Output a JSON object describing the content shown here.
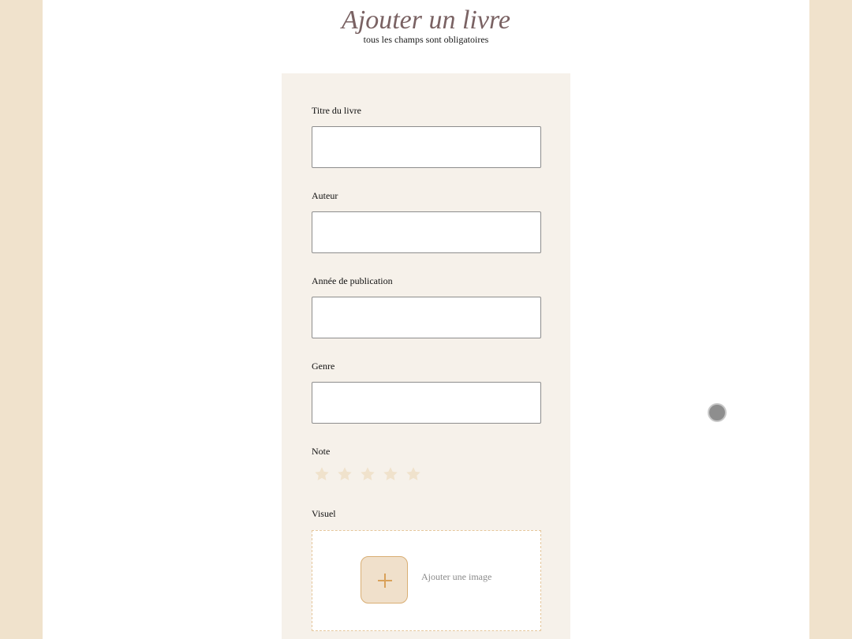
{
  "header": {
    "title": "Ajouter un livre",
    "subtitle": "tous les champs sont obligatoires"
  },
  "form": {
    "fields": [
      {
        "label": "Titre du livre",
        "value": "",
        "placeholder": ""
      },
      {
        "label": "Auteur",
        "value": "",
        "placeholder": ""
      },
      {
        "label": "Année de publication",
        "value": "",
        "placeholder": ""
      },
      {
        "label": "Genre",
        "value": "",
        "placeholder": ""
      }
    ],
    "rating": {
      "label": "Note",
      "value": 0,
      "max": 5
    },
    "visual": {
      "label": "Visuel",
      "add_label": "Ajouter une image"
    }
  },
  "colors": {
    "background": "#f0e2cc",
    "title": "#7a6263",
    "card": "#f6f1ea",
    "star_empty": "#f0e2cc",
    "accent": "#d9ae74"
  }
}
